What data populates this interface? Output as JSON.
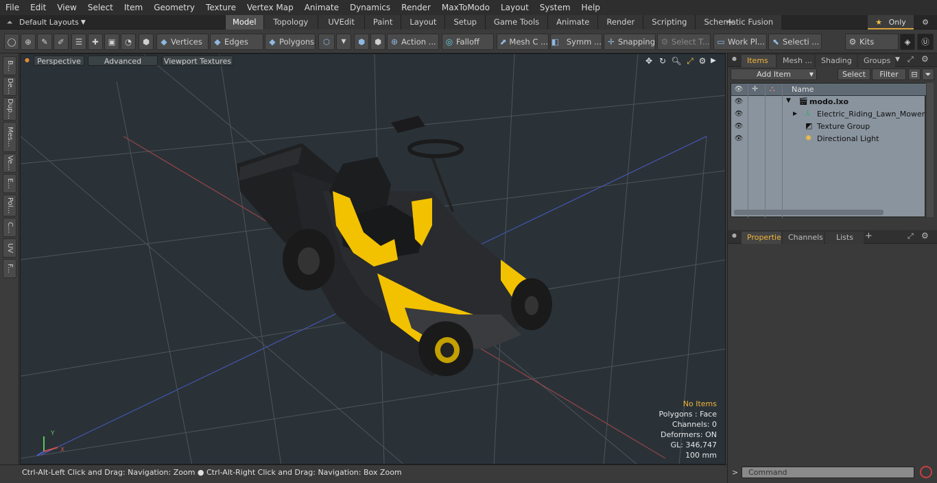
{
  "menu": [
    "File",
    "Edit",
    "View",
    "Select",
    "Item",
    "Geometry",
    "Texture",
    "Vertex Map",
    "Animate",
    "Dynamics",
    "Render",
    "MaxToModo",
    "Layout",
    "System",
    "Help"
  ],
  "layout_selector": {
    "label": "Default Layouts"
  },
  "tabs": [
    {
      "label": "Model",
      "active": true
    },
    {
      "label": "Topology"
    },
    {
      "label": "UVEdit"
    },
    {
      "label": "Paint"
    },
    {
      "label": "Layout"
    },
    {
      "label": "Setup"
    },
    {
      "label": "Game Tools"
    },
    {
      "label": "Animate"
    },
    {
      "label": "Render"
    },
    {
      "label": "Scripting"
    },
    {
      "label": "Schematic Fusion"
    }
  ],
  "only_button": {
    "star": "★",
    "label": "Only"
  },
  "toolbar": {
    "vertices": "Vertices",
    "edges": "Edges",
    "polygons": "Polygons",
    "action": "Action ...",
    "falloff": "Falloff",
    "mesh": "Mesh C ...",
    "symm": "Symm ...",
    "snapping": "Snapping",
    "select_t": "Select T...",
    "workplane": "Work Pl...",
    "selecti": "Selecti ...",
    "kits": "Kits"
  },
  "left_tabs": [
    "B...",
    "De...",
    "Dup...",
    "Mes...",
    "Ve...",
    "E...",
    "Pol...",
    "C...",
    "UV",
    "F..."
  ],
  "viewport": {
    "perspective": "Perspective",
    "advanced": "Advanced",
    "viewport_textures": "Viewport Textures",
    "info": {
      "no_items": "No Items",
      "polygons": "Polygons : Face",
      "channels": "Channels: 0",
      "deformers": "Deformers: ON",
      "gl": "GL: 346,747",
      "scale": "100 mm"
    }
  },
  "status": "Ctrl-Alt-Left Click and Drag: Navigation: Zoom ● Ctrl-Alt-Right Click and Drag: Navigation: Box Zoom",
  "items_panel": {
    "tabs": [
      "Items",
      "Mesh ...",
      "Shading",
      "Groups"
    ],
    "add_item": "Add Item",
    "select": "Select",
    "filter": "Filter",
    "name_header": "Name",
    "tree": [
      {
        "label": "modo.lxo",
        "level": 0
      },
      {
        "label": "Electric_Riding_Lawn_Mower ...",
        "level": 1
      },
      {
        "label": "Texture Group",
        "level": 1
      },
      {
        "label": "Directional Light",
        "level": 1
      }
    ]
  },
  "properties_panel": {
    "tabs": [
      "Properties",
      "Channels",
      "Lists"
    ]
  },
  "command": {
    "placeholder": "Command"
  },
  "colors": {
    "accent": "#f0b43a",
    "viewport_bg": "#2a3238",
    "mower_yellow": "#f2c200"
  }
}
